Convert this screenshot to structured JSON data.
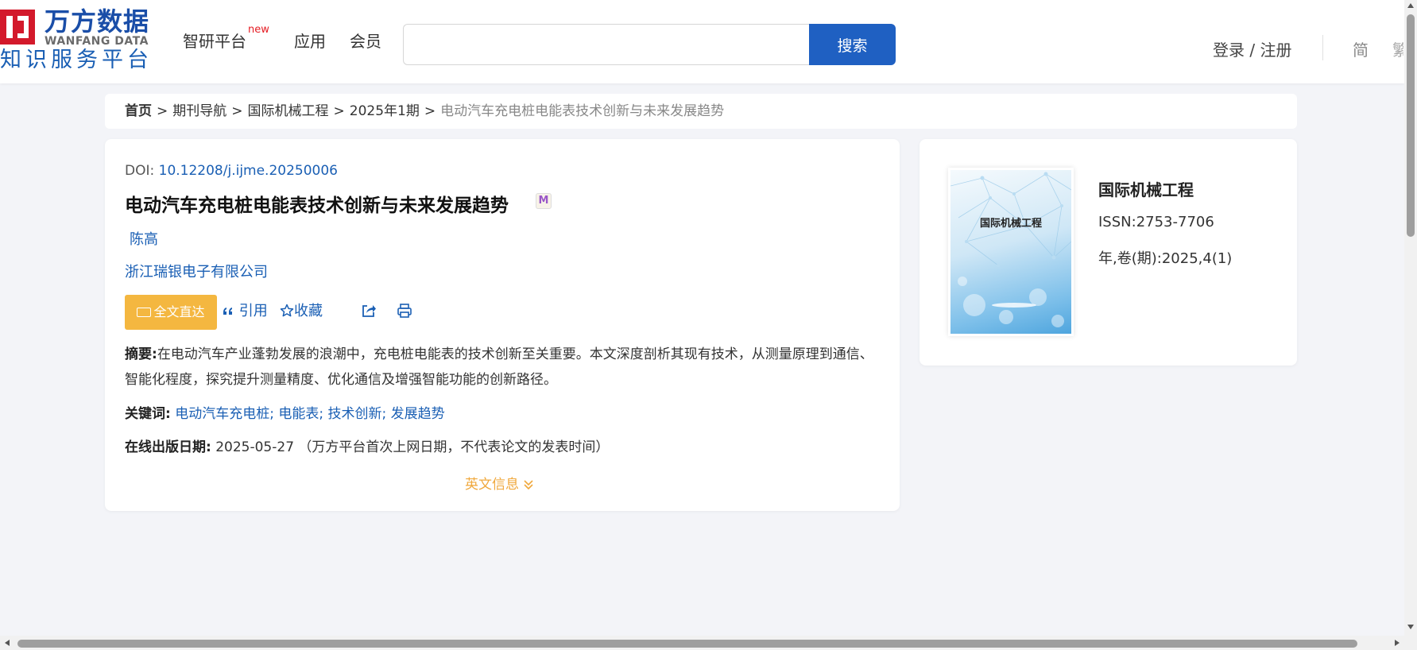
{
  "header": {
    "logo": {
      "name_cn": "万方数据",
      "name_en": "WANFANG DATA",
      "subtitle": "知识服务平台"
    },
    "nav": [
      {
        "label": "智研平台",
        "badge": "new"
      },
      {
        "label": "应用"
      },
      {
        "label": "会员"
      }
    ],
    "search": {
      "value": "",
      "placeholder": "",
      "button_label": "搜索"
    },
    "login_label": "登录 / 注册",
    "lang_simplified": "简",
    "lang_traditional": "繁"
  },
  "breadcrumb": {
    "items": [
      "首页",
      "期刊导航",
      "国际机械工程",
      "2025年1期"
    ],
    "separator": ">",
    "current": "电动汽车充电桩电能表技术创新与未来发展趋势"
  },
  "article": {
    "doi_label": "DOI:",
    "doi": "10.12208/j.ijme.20250006",
    "title": "电动汽车充电桩电能表技术创新与未来发展趋势",
    "title_badge": "M",
    "author": "陈高",
    "organization": "浙江瑞银电子有限公司",
    "actions": {
      "full_text": "全文直达",
      "cite": "引用",
      "favorite": "收藏"
    },
    "abstract_label": "摘要:",
    "abstract": "在电动汽车产业蓬勃发展的浪潮中，充电桩电能表的技术创新至关重要。本文深度剖析其现有技术，从测量原理到通信、智能化程度，探究提升测量精度、优化通信及增强智能功能的创新路径。",
    "keywords_label": "关键词:",
    "keywords": [
      "电动汽车充电桩",
      "电能表",
      "技术创新",
      "发展趋势"
    ],
    "keyword_separator": ";",
    "pubdate_label": "在线出版日期:",
    "pubdate": "2025-05-27",
    "pubdate_note": "（万方平台首次上网日期，不代表论文的发表时间）",
    "english_info_label": "英文信息"
  },
  "journal": {
    "cover_title": "国际机械工程",
    "name": "国际机械工程",
    "issn_label": "ISSN:",
    "issn": "2753-7706",
    "year_label": "年,卷(期):",
    "year_volume_issue": "2025,4(1)"
  },
  "colors": {
    "brand_blue": "#1f60c2",
    "link_blue": "#1a5fb4",
    "logo_red": "#d3192b",
    "fulltext_orange": "#f4b740",
    "english_info_orange": "#f0a83c"
  }
}
